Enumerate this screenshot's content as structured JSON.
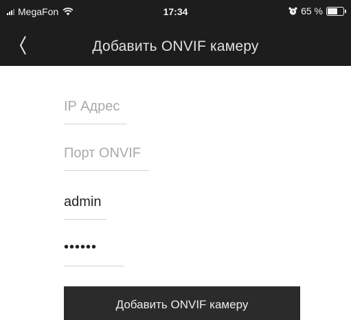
{
  "status_bar": {
    "carrier": "MegaFon",
    "time": "17:34",
    "battery_text": "65 %",
    "battery_level": 0.65,
    "icons": [
      "signal-icon",
      "wifi-icon",
      "alarm-icon",
      "battery-icon"
    ]
  },
  "nav": {
    "back_icon": "chevron-left-icon",
    "title": "Добавить ONVIF камеру"
  },
  "form": {
    "ip_placeholder": "IP Адрес",
    "ip_value": "",
    "port_placeholder": "Порт ONVIF",
    "port_value": "",
    "username_value": "admin",
    "password_value": "••••••",
    "submit_label": "Добавить ONVIF камеру"
  },
  "colors": {
    "bar_background": "#1d1d1d",
    "button_background": "#2b2b2b",
    "placeholder": "#a9a9a9",
    "underline": "#d3d3d3"
  }
}
